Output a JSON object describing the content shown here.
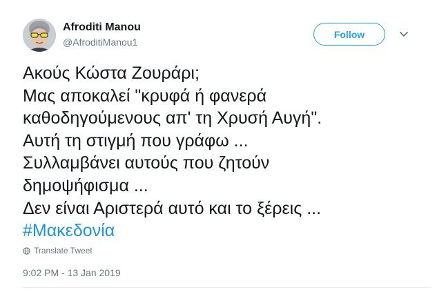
{
  "author": {
    "display_name": "Afroditi Manou",
    "handle": "@AfroditiManou1",
    "avatar_icon": "avatar-with-yellow-sunglasses"
  },
  "follow_button": {
    "label": "Follow"
  },
  "menu": {
    "icon": "chevron-down-icon"
  },
  "tweet": {
    "lines": [
      "Ακούς Κώστα Ζουράρι;",
      "Μας αποκαλεί \"κρυφά ή φανερά",
      "καθοδηγούμενους απ' τη Χρυσή Αυγή\".",
      "Αυτή τη στιγμή που γράφω ...",
      "Συλλαμβάνει αυτούς που ζητούν",
      "δημοψήφισμα ...",
      "Δεν είναι Αριστερά αυτό και το ξέρεις ..."
    ],
    "hashtag": "#Μακεδονία"
  },
  "translate": {
    "label": "Translate Tweet",
    "icon": "globe-icon"
  },
  "timestamp": "9:02 PM - 13 Jan 2019",
  "colors": {
    "accent": "#1da1f2",
    "hashtag": "#1b95e0",
    "text": "#14171a",
    "secondary": "#657786"
  }
}
